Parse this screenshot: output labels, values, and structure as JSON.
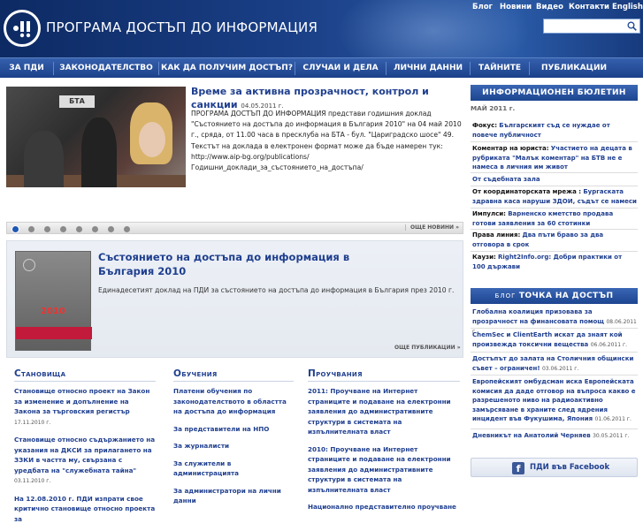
{
  "header": {
    "site_title": "ПРОГРАМА ДОСТЪП ДО ИНФОРМАЦИЯ",
    "top_links": [
      "Блог",
      "Новини",
      "Видео",
      "Контакти",
      "English"
    ],
    "search_placeholder": ""
  },
  "nav": {
    "items": [
      "ЗА ПДИ",
      "ЗАКОНОДАТЕЛСТВО",
      "КАК ДА ПОЛУЧИМ ДОСТЪП?",
      "СЛУЧАИ И ДЕЛА",
      "ЛИЧНИ ДАННИ",
      "ТАЙНИТЕ",
      "ПУБЛИКАЦИИ"
    ]
  },
  "featured": {
    "photo_sign": "БТА",
    "title": "Време за активна прозрачност, контрол и санкции",
    "date": "04.05.2011 г.",
    "text": "ПРОГРАМА ДОСТЪП ДО ИНФОРМАЦИЯ представи годишния доклад \"Състоянието на достъпа до информация в България 2010\" на 04 май 2010 г., сряда, от 11.00 часа в пресклуба на БТА - бул. \"Цариградско шосе\" 49. Текстът на доклада в електронен формат може да бъде намерен тук: http://www.aip-bg.org/publications/Годишни_доклади_за_състоянието_на_достъпа/",
    "more_news": "ОЩЕ НОВИНИ »",
    "slide_count": 8,
    "active_slide": 0
  },
  "report": {
    "cover_year": "2010",
    "title": "Състоянието на достъпа до информация в България 2010",
    "description": "Единадесетият доклад на ПДИ за състоянието на достъпа до информация в България през 2010 г.",
    "more_pubs": "ОЩЕ ПУБЛИКАЦИИ »"
  },
  "columns": [
    {
      "heading": "Становища",
      "items": [
        {
          "text": "Становище относно проект на Закон за изменение и допълнение на Закона за търговския регистър",
          "date": "17.11.2010 г."
        },
        {
          "text": "Становище относно съдържанието на указания на ДКСИ за прилагането на ЗЗКИ в частта му, свързана с уредбата на \"служебната тайна\"",
          "date": "03.11.2010 г."
        },
        {
          "text": "На 12.08.2010 г. ПДИ изпрати свое критично становище относно проекта за",
          "date": ""
        }
      ]
    },
    {
      "heading": "Обучения",
      "items": [
        {
          "text": "Платени обучения по законодателството в областта на достъпа до информация",
          "date": ""
        },
        {
          "text": "За представители на НПО",
          "date": ""
        },
        {
          "text": "За журналисти",
          "date": ""
        },
        {
          "text": "За служители в администрацията",
          "date": ""
        },
        {
          "text": "За администратори на лични данни",
          "date": ""
        }
      ]
    },
    {
      "heading": "Проучвания",
      "items": [
        {
          "text": "2011: Проучване на Интернет страниците и подаване на електронни заявления до административните структури в системата на изпълнителната власт",
          "date": ""
        },
        {
          "text": "2010: Проучване на Интернет страниците и подаване на електронни заявления до административните структури в системата на изпълнителната власт",
          "date": ""
        },
        {
          "text": "Национално представително проучване",
          "date": ""
        }
      ]
    }
  ],
  "bulletin": {
    "heading": "ИНФОРМАЦИОНЕН БЮЛЕТИН",
    "month": "МАЙ 2011 г.",
    "entries": [
      {
        "label": "Фокус:",
        "text": "Българският съд се нуждае от повече публичност"
      },
      {
        "label": "Коментар на юриста:",
        "text": "Участието на децата в рубриката \"Малък коментар\" на БТВ не е намеса в личния им живот"
      },
      {
        "label": "",
        "text": "От съдебната зала"
      },
      {
        "label": "От координаторската мрежа :",
        "text": "Бургаската здравна каса наруши ЗДОИ, съдът се намеси"
      },
      {
        "label": "Импулси:",
        "text": "Варненско кметство продава готови заявления за 60 стотинки"
      },
      {
        "label": "Права линия:",
        "text": "Два пъти браво за два отговора в срок"
      },
      {
        "label": "Каузи:",
        "text": "Right2Info.org: Добри практики от 100 държави"
      }
    ]
  },
  "blog": {
    "word": "БЛОГ",
    "heading": "ТОЧКА НА ДОСТЪП",
    "entries": [
      {
        "text": "Глобална коалиция призовава за прозрачност на финансовата помощ",
        "date": "08.06.2011 г."
      },
      {
        "text": "ChemSec и ClientEarth искат да знаят кой произвежда токсични вещества",
        "date": "06.06.2011 г."
      },
      {
        "text": "Достъпът до залата на Столичния общински съвет – ограничен!",
        "date": "03.06.2011 г."
      },
      {
        "text": "Европейският омбудсман иска Европейската комисия да даде отговор на въпроса какво е разрешеното ниво на радиоактивно замърсяване в храните след ядрения инцидент във Фукушима, Япония",
        "date": "01.06.2011 г."
      },
      {
        "text": "Дневникът на Анатолий Черняев",
        "date": "30.05.2011 г."
      }
    ]
  },
  "facebook": {
    "icon": "f",
    "label": "ПДИ във Facebook"
  }
}
